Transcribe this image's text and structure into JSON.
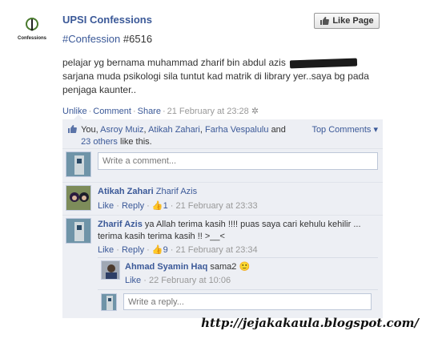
{
  "page": {
    "name": "UPSI Confessions",
    "logo_caption": "Confessions",
    "like_button": "Like Page"
  },
  "post": {
    "hashtag": "#Confession",
    "number": "#6516",
    "text_line1": "pelajar yg bernama muhammad zharif bin abdul azis",
    "text_rest": "sarjana muda psikologi sila tuntut kad matrik di library yer..saya bg pada penjaga kaunter..",
    "actions": {
      "unlike": "Unlike",
      "comment": "Comment",
      "share": "Share",
      "timestamp": "21 February at 23:28"
    }
  },
  "likes": {
    "prefix": "You,",
    "names": [
      "Asroy Muiz",
      "Atikah Zahari",
      "Farha Vespalulu"
    ],
    "and": "and",
    "others": "23 others",
    "suffix": "like this.",
    "top_comments": "Top Comments ▾"
  },
  "composer": {
    "placeholder": "Write a comment..."
  },
  "comments": [
    {
      "name": "Atikah Zahari",
      "text": "Zharif Azis",
      "like": "Like",
      "reply": "Reply",
      "likes": "1",
      "timestamp": "21 February at 23:33"
    },
    {
      "name": "Zharif Azis",
      "text": "ya Allah terima kasih !!!! puas saya cari kehulu kehilir ... terima kasih terima kasih !! >__<",
      "like": "Like",
      "reply": "Reply",
      "likes": "9",
      "timestamp": "21 February at 23:34"
    }
  ],
  "reply": {
    "name": "Ahmad Syamin Haq",
    "text": "sama2",
    "emoji": "🙂",
    "like": "Like",
    "timestamp": "22 February at 10:06"
  },
  "reply_composer": {
    "placeholder": "Write a reply..."
  },
  "watermark": "http://jejakakaula.blogspot.com/"
}
